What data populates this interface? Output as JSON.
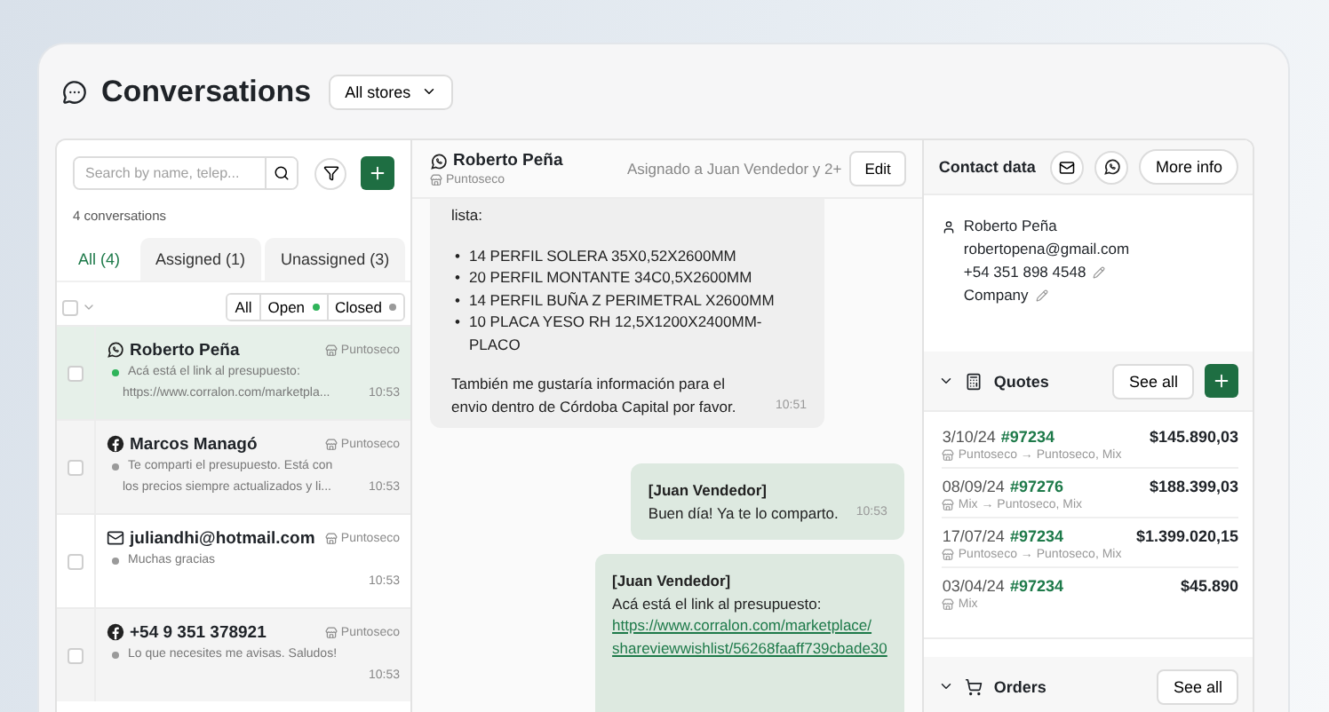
{
  "header": {
    "title": "Conversations",
    "store_select": "All stores"
  },
  "conversations": {
    "search_placeholder": "Search by name, telep...",
    "count": "4 conversations",
    "tabs": [
      {
        "label": "All (4)",
        "selected": true
      },
      {
        "label": "Assigned (1)",
        "selected": false
      },
      {
        "label": "Unassigned (3)",
        "selected": false
      }
    ],
    "select_all": {
      "checked": false
    },
    "status_filters": [
      {
        "label": "All"
      },
      {
        "label": "Open",
        "color": "#2fb45a"
      },
      {
        "label": "Closed",
        "color": "#9a9a9a"
      }
    ],
    "items": [
      {
        "kind": "whatsapp",
        "name": "Roberto Peña",
        "store": "Puntoseco",
        "color": "#2fb45a",
        "preview": [
          "Acá está el link al presupuesto:",
          "https://www.corralon.com/marketpla..."
        ],
        "time": "10:53",
        "selected": true,
        "checked": false
      },
      {
        "kind": "facebook",
        "name": "Marcos Managó",
        "store": "Puntoseco",
        "color": "#9a9a9a",
        "preview": [
          "Te comparti el presupuesto. Está con",
          "los precios siempre actualizados y li..."
        ],
        "time": "10:53",
        "selected": false,
        "checked": false
      },
      {
        "kind": "email",
        "name": "juliandhi@hotmail.com",
        "store": "Puntoseco",
        "color": "#9a9a9a",
        "preview": [
          "Muchas gracias"
        ],
        "time": "10:53",
        "selected": false,
        "checked": false
      },
      {
        "kind": "facebook",
        "name": "+54 9 351 378921",
        "store": "Puntoseco",
        "color": "#9a9a9a",
        "preview": [
          "Lo que necesites me avisas. Saludos!"
        ],
        "time": "10:53",
        "selected": false,
        "checked": false
      }
    ]
  },
  "chat": {
    "kind": "whatsapp",
    "name": "Roberto Peña",
    "store": "Puntoseco",
    "assigned": "Asignado a Juan Vendedor y 2+",
    "edit": "Edit",
    "messages": [
      {
        "kind": "incoming",
        "intro": "lista:",
        "bullet": "•",
        "list": [
          "14 PERFIL SOLERA 35X0,52X2600MM",
          "20 PERFIL MONTANTE 34C0,5X2600MM",
          "14 PERFIL BUÑA Z PERIMETRAL X2600MM",
          "10 PLACA YESO RH 12,5X1200X2400MM-PLACO"
        ],
        "text": "También me gustaría información para el envio dentro de Córdoba Capital por favor.",
        "time": "10:51"
      },
      {
        "kind": "outgoing",
        "author": "[Juan Vendedor]",
        "text": "Buen día! Ya te lo comparto.",
        "time": "10:53"
      },
      {
        "kind": "outgoing",
        "author": "[Juan Vendedor]",
        "text": "Acá está el link al presupuesto:",
        "link": [
          "https://www.corralon.com/marketplace/",
          "shareviewwishlist/56268faaff739cbade30"
        ]
      }
    ]
  },
  "contact": {
    "title": "Contact data",
    "more_info": "More info",
    "name": "Roberto Peña",
    "email": "robertopena@gmail.com",
    "phone": "+54 351 898 4548",
    "company": "Company"
  },
  "quotes": {
    "title": "Quotes",
    "see_all": "See all",
    "expanded": true,
    "items": [
      {
        "date": "3/10/24",
        "number": "#97234",
        "amount": "$145.890,03",
        "route": "Puntoseco → Puntoseco, Mix"
      },
      {
        "date": "08/09/24",
        "number": "#97276",
        "amount": "$188.399,03",
        "route": "Mix → Puntoseco, Mix"
      },
      {
        "date": "17/07/24",
        "number": "#97234",
        "amount": "$1.399.020,15",
        "route": "Puntoseco → Puntoseco, Mix"
      },
      {
        "date": "03/04/24",
        "number": "#97234",
        "amount": "$45.890",
        "route": "Mix"
      }
    ]
  },
  "orders": {
    "title": "Orders",
    "see_all": "See all"
  }
}
